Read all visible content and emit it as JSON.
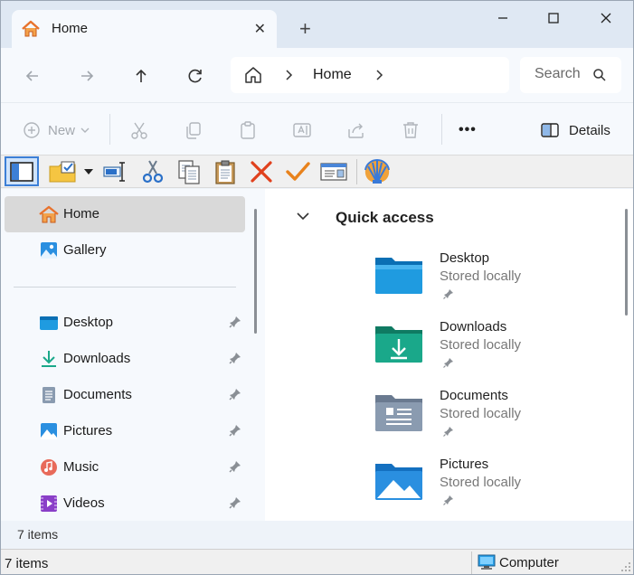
{
  "window": {
    "tab_title": "Home",
    "tab_close": "✕",
    "new_tab": "+"
  },
  "address": {
    "crumb": "Home",
    "search_placeholder": "Search"
  },
  "commandbar": {
    "new_label": "New",
    "details_label": "Details",
    "more": "•••"
  },
  "sidebar": {
    "top_items": [
      {
        "label": "Home",
        "icon": "home-icon",
        "selected": true
      },
      {
        "label": "Gallery",
        "icon": "gallery-icon",
        "selected": false
      }
    ],
    "pinned_items": [
      {
        "label": "Desktop",
        "icon": "desktop-folder-icon"
      },
      {
        "label": "Downloads",
        "icon": "download-icon"
      },
      {
        "label": "Documents",
        "icon": "document-icon"
      },
      {
        "label": "Pictures",
        "icon": "pictures-icon"
      },
      {
        "label": "Music",
        "icon": "music-icon"
      },
      {
        "label": "Videos",
        "icon": "video-icon"
      }
    ],
    "item_count": "7 items"
  },
  "content": {
    "section_title": "Quick access",
    "items": [
      {
        "name": "Desktop",
        "status": "Stored locally",
        "color": "#1f9be0"
      },
      {
        "name": "Downloads",
        "status": "Stored locally",
        "color": "#1aa88a"
      },
      {
        "name": "Documents",
        "status": "Stored locally",
        "color": "#8a9bb0"
      },
      {
        "name": "Pictures",
        "status": "Stored locally",
        "color": "#2a8fe0"
      }
    ]
  },
  "statusbar": {
    "items": "7 items",
    "location": "Computer"
  },
  "colors": {
    "accent": "#005fb8",
    "home_orange": "#e8722c",
    "delete_red": "#e0401c",
    "check_orange": "#e8821c"
  }
}
